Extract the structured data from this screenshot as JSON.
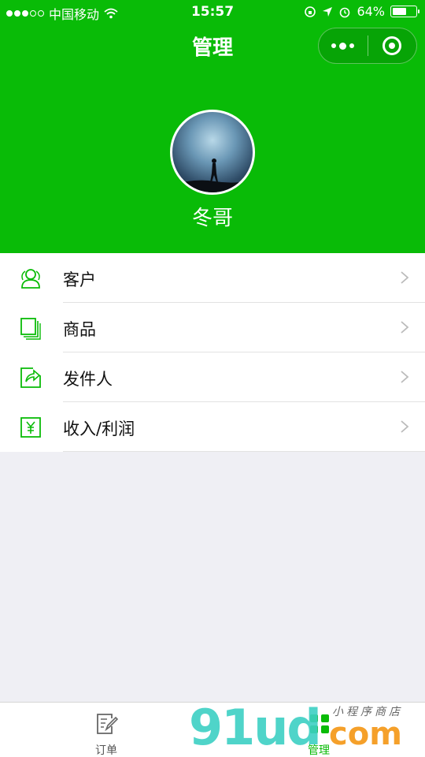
{
  "status_bar": {
    "carrier": "中国移动",
    "time": "15:57",
    "battery_text": "64%",
    "battery_level": 0.64
  },
  "nav": {
    "title": "管理"
  },
  "profile": {
    "name": "冬哥"
  },
  "menu": {
    "items": [
      {
        "label": "客户",
        "icon": "customers-icon"
      },
      {
        "label": "商品",
        "icon": "products-icon"
      },
      {
        "label": "发件人",
        "icon": "sender-icon"
      },
      {
        "label": "收入/利润",
        "icon": "income-icon"
      }
    ]
  },
  "tabbar": {
    "tabs": [
      {
        "label": "订单",
        "icon": "orders-icon"
      },
      {
        "label": "管理",
        "icon": "manage-icon",
        "active": true
      }
    ]
  },
  "watermark": {
    "brand": "91ud",
    "suffix": "com",
    "tagline": "小程序商店"
  },
  "colors": {
    "primary": "#09bb07",
    "background": "#efeff4",
    "text": "#111111"
  }
}
